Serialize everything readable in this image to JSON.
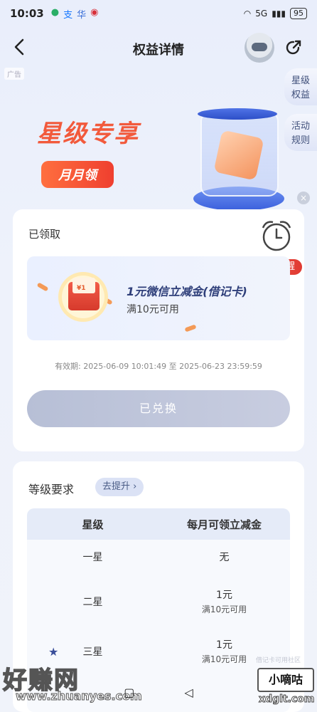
{
  "status_bar": {
    "time": "10:03",
    "app_icons": [
      "wechat-icon",
      "alipay-icon",
      "huawei-icon",
      "bank-icon"
    ],
    "network": "5G",
    "battery": "95"
  },
  "header": {
    "title": "权益详情"
  },
  "ad_tag": "广告",
  "side_tabs": [
    "星级\n权益",
    "活动\n规则"
  ],
  "banner": {
    "headline": "星级专享",
    "pill": "月月领"
  },
  "benefit": {
    "status": "已领取",
    "remind_label": "添加提醒",
    "envelope_tag": "¥1",
    "coupon_name": "1元微信立减金(借记卡)",
    "coupon_condition": "满10元可用",
    "validity": "有效期: 2025-06-09 10:01:49 至 2025-06-23 23:59:59",
    "button_label": "已兑换"
  },
  "level": {
    "title": "等级要求",
    "upgrade_label": "去提升",
    "headers": [
      "星级",
      "每月可领立减金"
    ],
    "rows": [
      {
        "level": "一星",
        "amount": "无",
        "condition": ""
      },
      {
        "level": "二星",
        "amount": "1元",
        "condition": "满10元可用"
      },
      {
        "level": "三星",
        "amount": "1元",
        "condition": "满10元可用"
      }
    ]
  },
  "watermarks": {
    "left_brand": "好赚网",
    "left_url": "www.zhuanyes.com",
    "right_brand": "小嘀咕",
    "right_url": "xdglt.com",
    "right_small": "借记卡可用社区"
  },
  "colors": {
    "accent": "#f25a3c",
    "primary_blue": "#3a5fdc",
    "disabled_button": "#c0c6da"
  }
}
